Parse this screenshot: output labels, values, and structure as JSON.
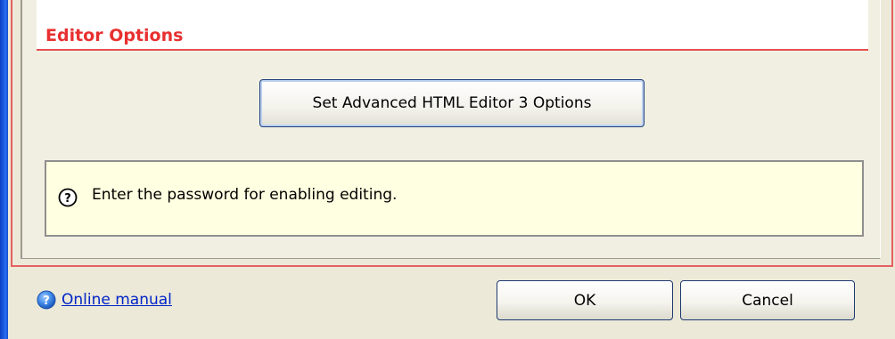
{
  "section": {
    "title": "Editor Options"
  },
  "advanced_button": {
    "label": "Set Advanced HTML Editor 3 Options"
  },
  "info": {
    "icon": "question-circle-icon",
    "text": "Enter the password for enabling editing."
  },
  "footer": {
    "help_icon": "help-icon",
    "help_link": "Online manual",
    "ok_label": "OK",
    "cancel_label": "Cancel"
  },
  "colors": {
    "section_title": "#e83030",
    "frame_border": "#e66060",
    "info_bg": "#ffffe1",
    "link": "#0024c8",
    "window_border": "#1a5ae0"
  }
}
